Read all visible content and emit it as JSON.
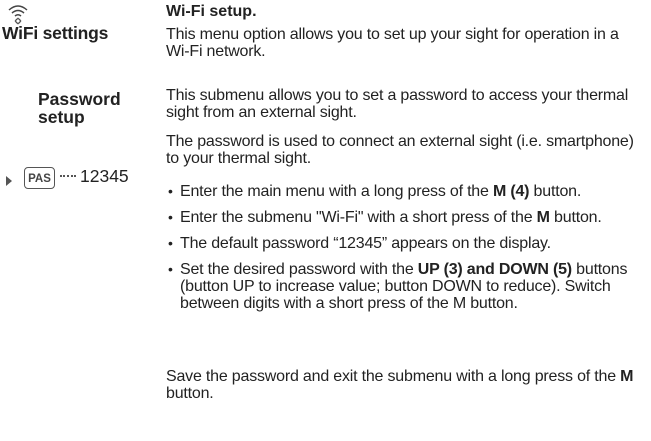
{
  "left": {
    "wifi_title": "WiFi settings",
    "password_title": "Password setup",
    "password_badge": "PAS",
    "password_value": "12345",
    "icons": [
      "wifi-settings-icon",
      "arrow-right-icon"
    ]
  },
  "right": {
    "heading": "Wi-Fi setup.",
    "para1": "This menu option allows you to set up your sight for operation in a Wi-Fi network.",
    "para2": "This submenu allows you to set a password to access your thermal sight from an external sight.",
    "para3": "The password is used to connect an external sight (i.e. smartphone) to your thermal sight.",
    "bullets": [
      {
        "before": "Enter the main menu with a long press of the ",
        "bold": "M (4)",
        "after": " button."
      },
      {
        "before": "Enter the submenu \"Wi-Fi\" with a short press of the ",
        "bold": "M",
        "after": " button."
      },
      {
        "before": "The default password “12345” appears on the display.",
        "bold": "",
        "after": ""
      },
      {
        "before": "Set the desired password with the ",
        "bold": "UP (3) and DOWN (5)",
        "after": " buttons (button UP to increase value; button DOWN to reduce). Switch between digits with a short press of the M button."
      }
    ],
    "para4_before": "Save the password and exit the submenu with a long press of the ",
    "para4_bold": "M",
    "para4_after": " button."
  }
}
